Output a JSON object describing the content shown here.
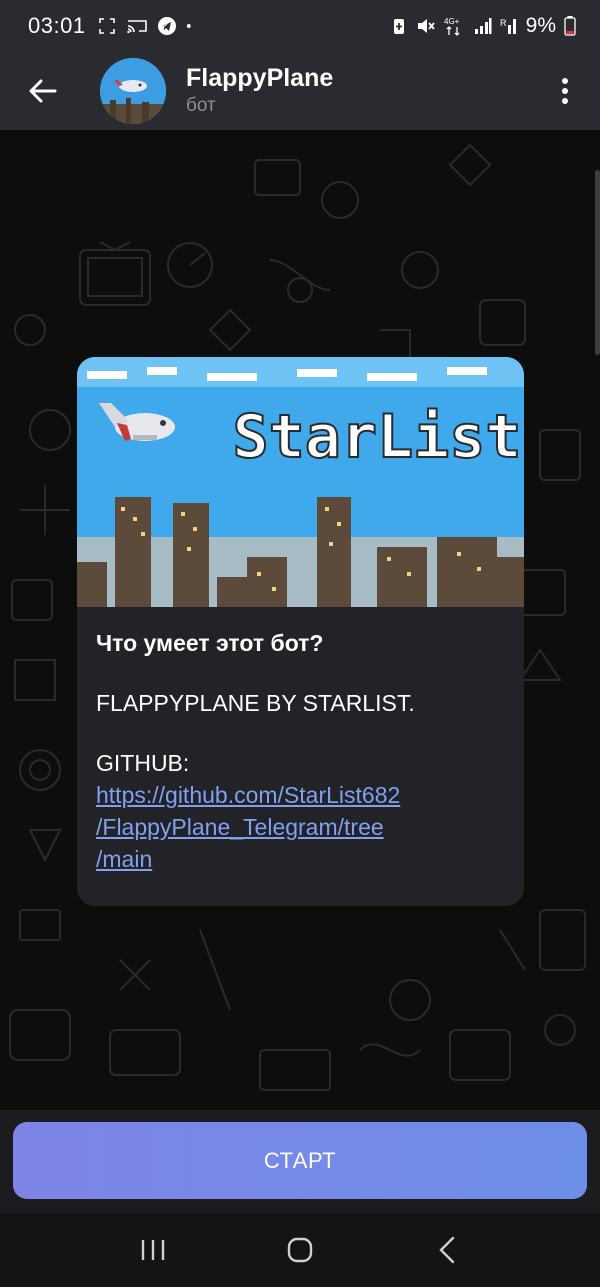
{
  "status_bar": {
    "time": "03:01",
    "battery": "9%",
    "left_icons": [
      "screenshot-icon",
      "cast-icon",
      "telegram-icon",
      "dot-icon"
    ],
    "right_icons": [
      "battery-saver-icon",
      "mute-icon",
      "4g-signal-icon",
      "signal-bars-icon",
      "signal-bars-2-icon",
      "battery-icon"
    ]
  },
  "header": {
    "title": "FlappyPlane",
    "subtitle": "бот",
    "back_icon": "arrow-left-icon",
    "menu_icon": "more-vertical-icon"
  },
  "card": {
    "image_text": "StarList",
    "title": "Что умеет этот бот?",
    "text": "FLAPPYPLANE BY STARLIST.",
    "github_label": "GITHUB:",
    "link": "https://github.com/StarList682/FlappyPlane_Telegram/tree/main",
    "link_lines": [
      "https://github.com/StarList682",
      "/FlappyPlane_Telegram/tree",
      "/main"
    ]
  },
  "bottom": {
    "start_label": "СТАРТ"
  },
  "nav": {
    "recents_icon": "recents-icon",
    "home_icon": "home-icon",
    "back_icon": "nav-back-icon"
  },
  "colors": {
    "header_bg": "#2a2b31",
    "chat_bg": "#0d0d0d",
    "card_bg": "#222227",
    "link": "#7ea1f0",
    "button_start": "#7d84e6",
    "button_end": "#6e8fe8"
  }
}
